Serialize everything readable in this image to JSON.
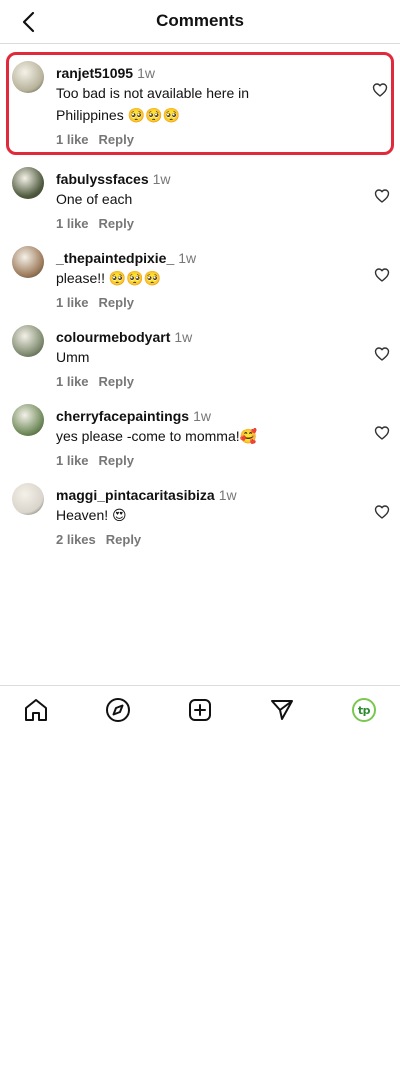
{
  "header": {
    "title": "Comments",
    "back_icon": "chevron-left-icon"
  },
  "comments": [
    {
      "username": "ranjet51095",
      "time": "1w",
      "text_lines": [
        "Too bad is not available here in",
        "Philippines 🥺🥺🥺"
      ],
      "likes": "1 like",
      "reply": "Reply",
      "highlighted": true,
      "avatar_color": "#b7b29a"
    },
    {
      "username": "fabulyssfaces",
      "time": "1w",
      "text_lines": [
        "One of each"
      ],
      "likes": "1 like",
      "reply": "Reply",
      "highlighted": false,
      "avatar_color": "#4f5a3e"
    },
    {
      "username": "_thepaintedpixie_",
      "time": "1w",
      "text_lines": [
        "please!! 🥺🥺🥺"
      ],
      "likes": "1 like",
      "reply": "Reply",
      "highlighted": false,
      "avatar_color": "#9c7a5a"
    },
    {
      "username": "colourmebodyart",
      "time": "1w",
      "text_lines": [
        "Umm"
      ],
      "likes": "1 like",
      "reply": "Reply",
      "highlighted": false,
      "avatar_color": "#7e8a6f"
    },
    {
      "username": "cherryfacepaintings",
      "time": "1w",
      "text_lines": [
        "yes please -come to momma!🥰"
      ],
      "likes": "1 like",
      "reply": "Reply",
      "highlighted": false,
      "avatar_color": "#6f8a5a"
    },
    {
      "username": "maggi_pintacaritasibiza",
      "time": "1w",
      "text_lines": [
        "Heaven! 😍"
      ],
      "likes": "2 likes",
      "reply": "Reply",
      "highlighted": false,
      "avatar_color": "#d9d4cc"
    }
  ],
  "nav": {
    "items": [
      "home-icon",
      "explore-icon",
      "create-icon",
      "direct-icon",
      "profile-icon"
    ],
    "profile_label": "tp",
    "accent": "#7ac74f",
    "highlight_border": "#e02a3c"
  }
}
